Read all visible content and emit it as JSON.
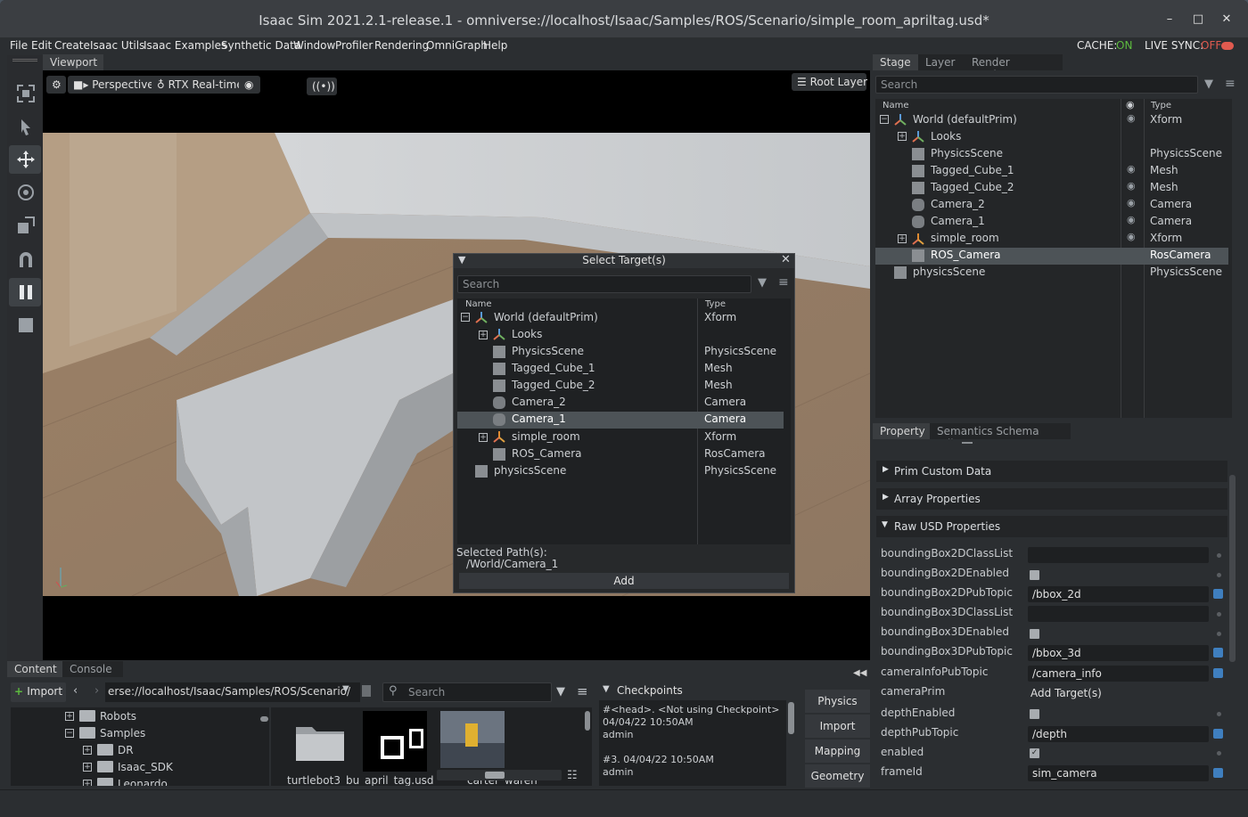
{
  "window": {
    "title": "Isaac Sim 2021.2.1-release.1 - omniverse://localhost/Isaac/Samples/ROS/Scenario/simple_room_apriltag.usd*",
    "min": "–",
    "max": "□",
    "close": "✕"
  },
  "menu": [
    "File",
    "Edit",
    "Create",
    "Isaac Utils",
    "Isaac Examples",
    "Synthetic Data",
    "Window",
    "Profiler",
    "Rendering",
    "OmniGraph",
    "Help"
  ],
  "cache": {
    "label": "CACHE:",
    "value": "ON",
    "on_color": "#5dbb3f"
  },
  "livesync": {
    "label": "LIVE SYNC:",
    "value": "OFF",
    "off_color": "#e05a4f"
  },
  "viewport": {
    "tab": "Viewport",
    "perspective": "Perspective",
    "render_mode": "RTX Real-time",
    "root_layer": "Root Layer",
    "broadcast": "((•))"
  },
  "dialog": {
    "title": "Select Target(s)",
    "search_placeholder": "Search",
    "col_name": "Name",
    "col_type": "Type",
    "rows": [
      {
        "name": "World (defaultPrim)",
        "type": "Xform"
      },
      {
        "name": "Looks",
        "type": ""
      },
      {
        "name": "PhysicsScene",
        "type": "PhysicsScene"
      },
      {
        "name": "Tagged_Cube_1",
        "type": "Mesh"
      },
      {
        "name": "Tagged_Cube_2",
        "type": "Mesh"
      },
      {
        "name": "Camera_2",
        "type": "Camera"
      },
      {
        "name": "Camera_1",
        "type": "Camera"
      },
      {
        "name": "simple_room",
        "type": "Xform"
      },
      {
        "name": "ROS_Camera",
        "type": "RosCamera"
      },
      {
        "name": "physicsScene",
        "type": "PhysicsScene"
      }
    ],
    "selected_label": "Selected Path(s):",
    "selected_path": "/World/Camera_1",
    "add_label": "Add"
  },
  "stage": {
    "tabs": [
      "Stage",
      "Layer",
      "Render Settings"
    ],
    "search_placeholder": "Search",
    "col_name": "Name",
    "col_type": "Type",
    "rows": [
      {
        "name": "World (defaultPrim)",
        "type": "Xform"
      },
      {
        "name": "Looks",
        "type": ""
      },
      {
        "name": "PhysicsScene",
        "type": "PhysicsScene"
      },
      {
        "name": "Tagged_Cube_1",
        "type": "Mesh"
      },
      {
        "name": "Tagged_Cube_2",
        "type": "Mesh"
      },
      {
        "name": "Camera_2",
        "type": "Camera"
      },
      {
        "name": "Camera_1",
        "type": "Camera"
      },
      {
        "name": "simple_room",
        "type": "Xform"
      },
      {
        "name": "ROS_Camera",
        "type": "RosCamera"
      },
      {
        "name": "physicsScene",
        "type": "PhysicsScene"
      }
    ]
  },
  "property": {
    "tabs": [
      "Property",
      "Semantics Schema Editor"
    ],
    "sections": [
      "Prim Custom Data",
      "Array Properties",
      "Raw USD Properties"
    ],
    "rows": [
      {
        "label": "boundingBox2DClassList",
        "kind": "field",
        "value": ""
      },
      {
        "label": "boundingBox2DEnabled",
        "kind": "check",
        "value": ""
      },
      {
        "label": "boundingBox2DPubTopic",
        "kind": "field",
        "value": "/bbox_2d"
      },
      {
        "label": "boundingBox3DClassList",
        "kind": "field",
        "value": ""
      },
      {
        "label": "boundingBox3DEnabled",
        "kind": "check",
        "value": ""
      },
      {
        "label": "boundingBox3DPubTopic",
        "kind": "field",
        "value": "/bbox_3d"
      },
      {
        "label": "cameraInfoPubTopic",
        "kind": "field",
        "value": "/camera_info"
      },
      {
        "label": "cameraPrim",
        "kind": "text",
        "value": "Add Target(s)"
      },
      {
        "label": "depthEnabled",
        "kind": "check",
        "value": ""
      },
      {
        "label": "depthPubTopic",
        "kind": "field",
        "value": "/depth"
      },
      {
        "label": "enabled",
        "kind": "checked",
        "value": "✓"
      },
      {
        "label": "frameId",
        "kind": "field",
        "value": "sim_camera"
      }
    ]
  },
  "content": {
    "tabs": [
      "Content",
      "Console"
    ],
    "import_label": "Import",
    "path": "erse://localhost/Isaac/Samples/ROS/Scenario/",
    "search_placeholder": "Search",
    "tree": [
      {
        "name": "Robots"
      },
      {
        "name": "Samples"
      },
      {
        "name": "DR"
      },
      {
        "name": "Isaac_SDK"
      },
      {
        "name": "Leonardo"
      }
    ],
    "files": [
      "turtlebot3_bu",
      "april_tag.usd",
      "carter_wareh"
    ],
    "checkpoints_title": "Checkpoints",
    "cp1_line1": "#<head>.   <Not using Checkpoint>",
    "cp1_line2": "04/04/22 10:50AM",
    "cp1_user": "admin",
    "cp2_line1": "#3.   04/04/22 10:50AM",
    "cp2_user": "admin"
  },
  "side_buttons": [
    "Physics",
    "Import",
    "Mapping",
    "Geometry"
  ],
  "side_collapse": "◀◀"
}
